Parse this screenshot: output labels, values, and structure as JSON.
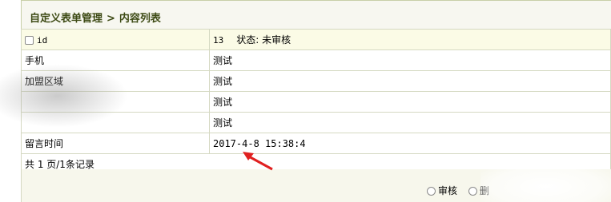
{
  "breadcrumb": {
    "section": "自定义表单管理",
    "separator": ">",
    "page": "内容列表"
  },
  "rows": {
    "id": {
      "label": "id",
      "value": "13",
      "status_label": "状态:",
      "status_value": "未审核"
    },
    "phone": {
      "label": "手机",
      "value": "测试"
    },
    "region": {
      "label": "加盟区域",
      "value": "测试"
    },
    "row4": {
      "value": "测试"
    },
    "row5": {
      "value": "测试"
    },
    "time": {
      "label": "留言时间",
      "value": "2017-4-8 15:38:4"
    }
  },
  "pagination": {
    "text": "共 1 页/1条记录"
  },
  "actions": {
    "approve": "审核",
    "delete": "删"
  },
  "colors": {
    "header_bg": "#f7f7f0",
    "breadcrumb_text": "#3d4a14",
    "arrow": "#e02020"
  }
}
